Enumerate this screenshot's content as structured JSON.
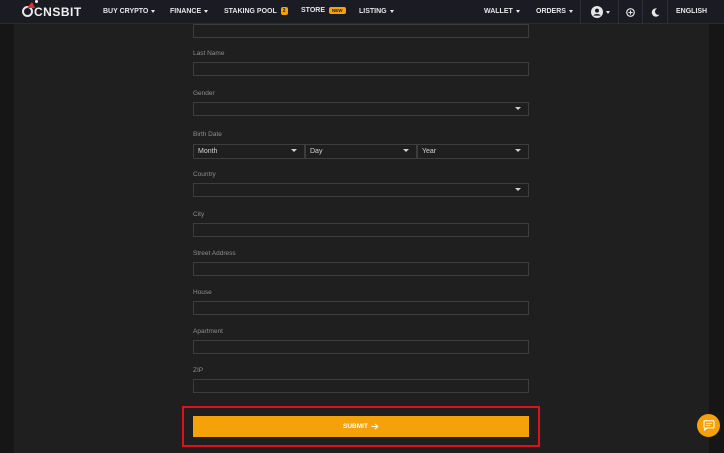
{
  "brand": {
    "name": "CNSBIT"
  },
  "nav": {
    "buy_crypto": "BUY CRYPTO",
    "finance": "FINANCE",
    "staking_pool": "STAKING POOL",
    "staking_badge": "2",
    "store": "STORE",
    "store_badge": "NEW",
    "listing": "LISTING",
    "wallet": "WALLET",
    "orders": "ORDERS",
    "language": "ENGLISH"
  },
  "form": {
    "last_name": {
      "label": "Last Name",
      "value": ""
    },
    "gender": {
      "label": "Gender",
      "value": ""
    },
    "birth_date": {
      "label": "Birth Date",
      "month": "Month",
      "day": "Day",
      "year": "Year"
    },
    "country": {
      "label": "Country",
      "value": ""
    },
    "city": {
      "label": "City",
      "value": ""
    },
    "street_address": {
      "label": "Street Address",
      "value": ""
    },
    "house": {
      "label": "House",
      "value": ""
    },
    "apartment": {
      "label": "Apartment",
      "value": ""
    },
    "zip": {
      "label": "ZIP",
      "value": ""
    },
    "submit_label": "SUBMIT"
  },
  "colors": {
    "accent": "#f5a20a",
    "highlight": "#e0101a",
    "background": "#161616",
    "panel": "#1f1f1f",
    "topbar": "#1b1b24"
  }
}
